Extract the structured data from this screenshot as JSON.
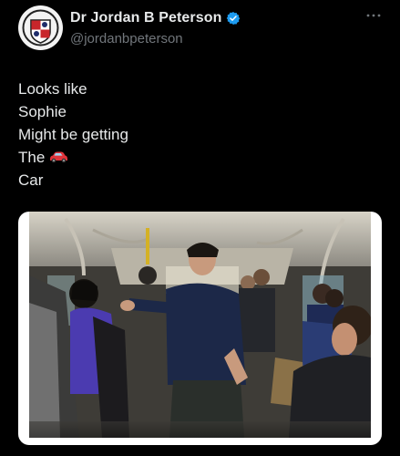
{
  "author": {
    "display_name": "Dr Jordan B Peterson",
    "handle": "@jordanbpeterson",
    "verified": true
  },
  "tweet": {
    "lines": [
      "Looks like",
      "Sophie",
      "Might be getting",
      "The",
      "Car"
    ],
    "emoji": "car-icon"
  },
  "media": {
    "description_icon": "subway-photo",
    "frame_color": "#ffffff"
  },
  "colors": {
    "background": "#000000",
    "text": "#e7e9ea",
    "secondary": "#71767b",
    "verified": "#1d9bf0"
  }
}
